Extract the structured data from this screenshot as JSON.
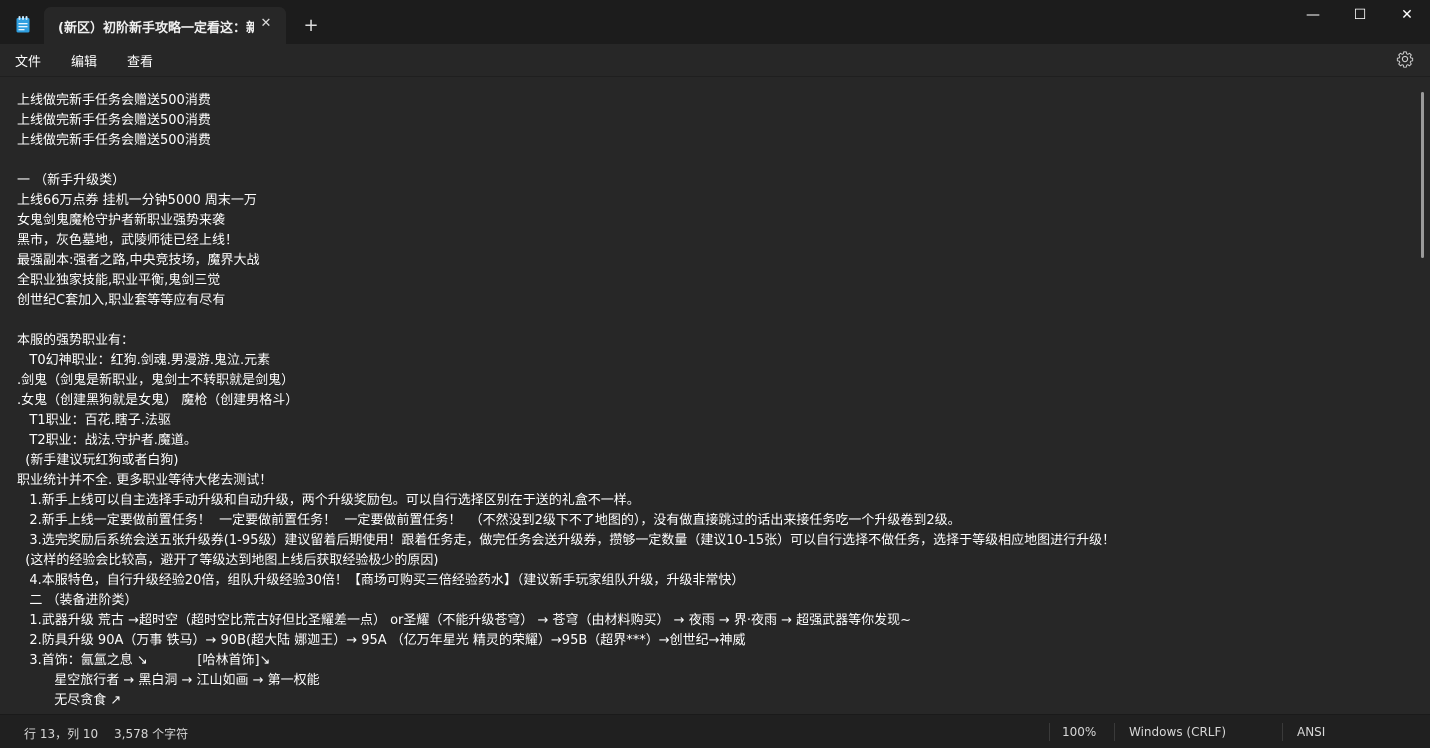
{
  "window": {
    "tab_title": "(新区）初阶新手攻略一定看这：新",
    "tab_close_glyph": "✕",
    "new_tab_glyph": "+",
    "minimize_glyph": "—",
    "maximize_glyph": "☐",
    "close_glyph": "✕",
    "app_icon": "notepad-icon",
    "accent": "#4cc2ff"
  },
  "menu": {
    "file": "文件",
    "edit": "编辑",
    "view": "查看",
    "settings_icon": "gear-icon"
  },
  "editor": {
    "lines": [
      "上线做完新手任务会赠送500消费",
      "上线做完新手任务会赠送500消费",
      "上线做完新手任务会赠送500消费",
      "",
      "一 （新手升级类）",
      "上线66万点券 挂机一分钟5000 周末一万",
      "女鬼剑鬼魔枪守护者新职业强势来袭",
      "黑市，灰色墓地，武陵师徒已经上线！",
      "最强副本:强者之路,中央竞技场，魔界大战",
      "全职业独家技能,职业平衡,鬼剑三觉",
      "创世纪C套加入,职业套等等应有尽有",
      "",
      "本服的强势职业有：",
      "   T0幻神职业：红狗.剑魂.男漫游.鬼泣.元素",
      ".剑鬼（剑鬼是新职业，鬼剑士不转职就是剑鬼）",
      ".女鬼（创建黑狗就是女鬼） 魔枪（创建男格斗）",
      "   T1职业：百花.瞎子.法驱",
      "   T2职业：战法.守护者.魔道。",
      "  (新手建议玩红狗或者白狗)",
      "职业统计并不全. 更多职业等待大佬去测试！",
      "   1.新手上线可以自主选择手动升级和自动升级，两个升级奖励包。可以自行选择区别在于送的礼盒不一样。",
      "   2.新手上线一定要做前置任务！  一定要做前置任务！  一定要做前置任务！  （不然没到2级下不了地图的），没有做直接跳过的话出来接任务吃一个升级卷到2级。",
      "   3.选完奖励后系统会送五张升级券(1-95级）建议留着后期使用！跟着任务走，做完任务会送升级券，攒够一定数量（建议10-15张）可以自行选择不做任务，选择于等级相应地图进行升级！",
      "  (这样的经验会比较高，避开了等级达到地图上线后获取经验极少的原因)",
      "   4.本服特色，自行升级经验20倍，组队升级经验30倍！【商场可购买三倍经验药水】（建议新手玩家组队升级，升级非常快）",
      "   二 （装备进阶类）",
      "   1.武器升级 荒古 →超时空（超时空比荒古好但比圣耀差一点） or圣耀（不能升级苍穹） → 苍穹（由材料购买） → 夜雨 → 界·夜雨 → 超强武器等你发现~",
      "   2.防具升级 90A（万事 铁马）→ 90B(超大陆 娜迦王）→ 95A （亿万年星光 精灵的荣耀）→95B（超界***）→创世纪→神威",
      "   3.首饰：氤氲之息 ↘            [哈林首饰]↘",
      "         星空旅行者 → 黑白洞 → 江山如画 → 第一权能",
      "         无尽贪食 ↗"
    ]
  },
  "status": {
    "cursor": "行 13，列 10",
    "char_count": "3,578 个字符",
    "zoom": "100%",
    "line_ending": "Windows (CRLF)",
    "encoding": "ANSI"
  }
}
